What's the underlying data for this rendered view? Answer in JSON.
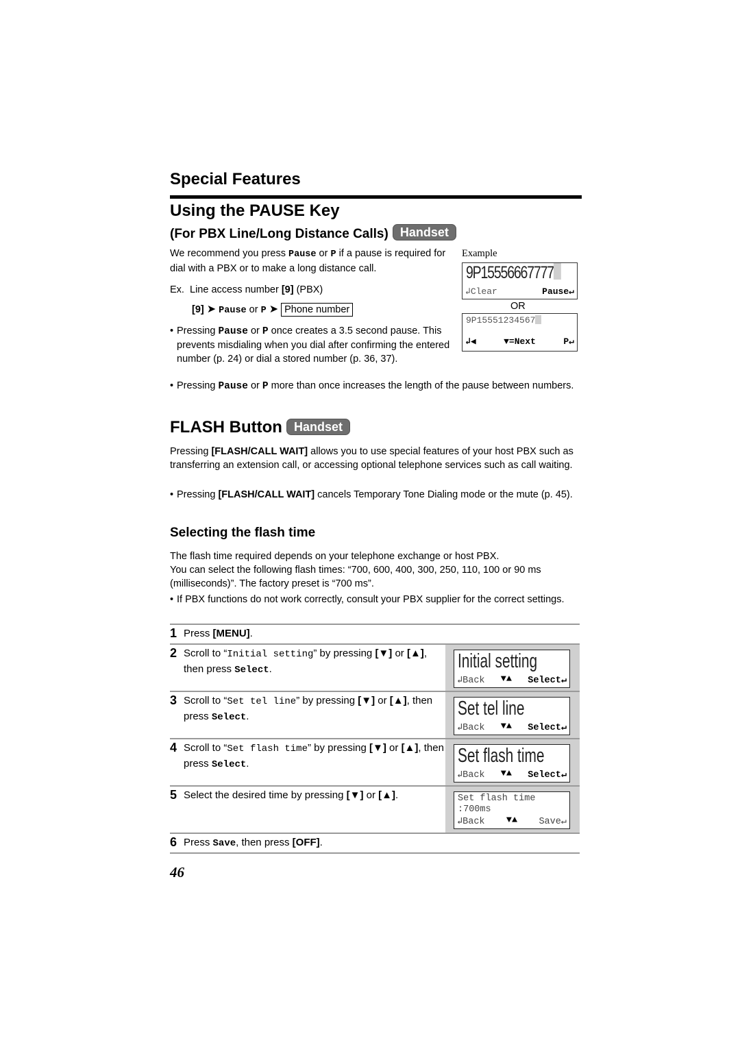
{
  "header": {
    "section_title": "Special Features",
    "page_title": "Using the PAUSE Key",
    "subtitle": "(For PBX Line/Long Distance Calls)",
    "badge": "Handset"
  },
  "pause": {
    "intro_pre": "We recommend you press ",
    "intro_key1": "Pause",
    "intro_or": " or ",
    "intro_key2": "P",
    "intro_post": " if a pause is required for dial with a PBX or to make a long distance call.",
    "example_label": "Example",
    "ex_prefix": "Ex.  Line access number ",
    "ex_key": "[9]",
    "ex_suffix": " (PBX)",
    "seq_key": "[9]",
    "seq_pause": "Pause",
    "seq_or": " or ",
    "seq_p": "P",
    "seq_box": "Phone number",
    "or_label": "OR",
    "lcd1": {
      "number": "9P15556667777",
      "soft_left": "↲Clear",
      "soft_right": "Pause↵"
    },
    "lcd2": {
      "number": "9P15551234567",
      "soft_left": "↲◀",
      "soft_mid": "▼=Next",
      "soft_right": "P↵"
    },
    "bullet1": {
      "pre": "Pressing ",
      "k1": "Pause",
      "or": " or ",
      "k2": "P",
      "post": " once creates a 3.5 second pause. This prevents misdialing when you dial after confirming the entered number (p. 24) or dial a stored number (p. 36, 37)."
    },
    "bullet2": {
      "pre": "Pressing ",
      "k1": "Pause",
      "or": " or ",
      "k2": "P",
      "post": " more than once increases the length of the pause between numbers."
    }
  },
  "flash": {
    "title": "FLASH Button",
    "badge": "Handset",
    "para_pre": "Pressing ",
    "para_key": "[FLASH/CALL WAIT]",
    "para_post": " allows you to use special features of your host PBX such as transferring an extension call, or accessing optional telephone services such as call waiting.",
    "bullet_pre": "Pressing ",
    "bullet_key": "[FLASH/CALL WAIT]",
    "bullet_post": " cancels Temporary Tone Dialing mode or the mute (p. 45)."
  },
  "selecting": {
    "title": "Selecting the flash time",
    "para1": "The flash time required depends on your telephone exchange or host PBX.",
    "para2": "You can select the following flash times: “700, 600, 400, 300, 250, 110, 100 or 90 ms (milliseconds)”. The factory preset is “700 ms”.",
    "bullet": "If PBX functions do not work correctly, consult your PBX supplier for the correct settings."
  },
  "steps": [
    {
      "num": "1",
      "pre": "Press ",
      "key": "[MENU]",
      "post": "."
    },
    {
      "num": "2",
      "pre": "Scroll to “",
      "item": "Initial setting",
      "mid": "” by pressing ",
      "down": "[▼]",
      "or": " or ",
      "up": "[▲]",
      "then": ", then press ",
      "soft": "Select",
      "end": ".",
      "lcd": {
        "text": "Initial setting",
        "soft_left": "↲Back",
        "soft_mid": "▼▲",
        "soft_right": "Select↵"
      }
    },
    {
      "num": "3",
      "pre": "Scroll to “",
      "item": "Set tel line",
      "mid": "” by pressing ",
      "down": "[▼]",
      "or": " or ",
      "up": "[▲]",
      "then": ", then press ",
      "soft": "Select",
      "end": ".",
      "lcd": {
        "text": "Set tel line",
        "soft_left": "↲Back",
        "soft_mid": "▼▲",
        "soft_right": "Select↵"
      }
    },
    {
      "num": "4",
      "pre": "Scroll to “",
      "item": "Set flash time",
      "mid": "” by pressing ",
      "down": "[▼]",
      "or": " or ",
      "up": "[▲]",
      "then": ", then press ",
      "soft": "Select",
      "end": ".",
      "lcd": {
        "text": "Set flash time",
        "soft_left": "↲Back",
        "soft_mid": "▼▲",
        "soft_right": "Select↵"
      }
    },
    {
      "num": "5",
      "pre": "Select the desired time by pressing ",
      "down": "[▼]",
      "or": " or ",
      "up": "[▲]",
      "end": ".",
      "lcd": {
        "line1": "Set flash time",
        "line2": ":700ms",
        "soft_left": "↲Back",
        "soft_mid": "▼▲",
        "soft_right": "Save↵"
      }
    },
    {
      "num": "6",
      "pre": "Press ",
      "soft": "Save",
      "then": ", then press ",
      "key": "[OFF]",
      "end": "."
    }
  ],
  "footer": {
    "page_number": "46"
  }
}
